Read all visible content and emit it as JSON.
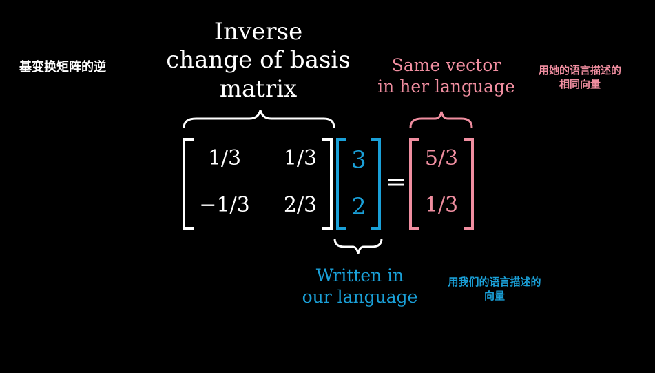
{
  "titles": {
    "chinese_title": "基变换矩阵的逆"
  },
  "labels": {
    "inverse_line1": "Inverse",
    "inverse_line2": "change of basis",
    "inverse_line3": "matrix",
    "same_line1": "Same vector",
    "same_line2": "in her language",
    "same_cn_line1": "用她的语言描述的",
    "same_cn_line2": "相同向量",
    "written_line1": "Written in",
    "written_line2": "our language",
    "written_cn_line1": "用我们的语言描述的",
    "written_cn_line2": "向量"
  },
  "matrix": {
    "a11": "1/3",
    "a12": "1/3",
    "a21": "−1/3",
    "a22": "2/3"
  },
  "vector_ours": {
    "v1": "3",
    "v2": "2"
  },
  "vector_hers": {
    "v1": "5/3",
    "v2": "1/3"
  },
  "equals": "=",
  "colors": {
    "background": "#000000",
    "white": "#ffffff",
    "blue": "#1aa0d8",
    "pink": "#f08ea0"
  }
}
